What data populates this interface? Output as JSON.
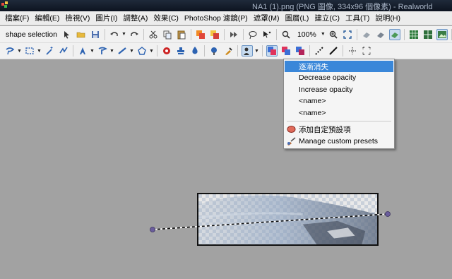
{
  "window": {
    "title": "NA1 (1).png (PNG 圖像, 334x96 個像素) - Realworld"
  },
  "menu": [
    "檔案(F)",
    "編輯(E)",
    "檢視(V)",
    "圖片(I)",
    "調整(A)",
    "效果(C)",
    "PhotoShop 濾鏡(P)",
    "遮罩(M)",
    "圖層(L)",
    "建立(C)",
    "工具(T)",
    "說明(H)"
  ],
  "toolbar1": {
    "tool_name": "shape selection",
    "zoom": "100%"
  },
  "dropdown": {
    "items": [
      {
        "label": "逐漸消失",
        "selected": true
      },
      {
        "label": "Decrease opacity"
      },
      {
        "label": "Increase opacity"
      },
      {
        "label": "<name>"
      },
      {
        "label": "<name>"
      }
    ],
    "presets": [
      {
        "label": "添加自定預設項",
        "icon": "add-preset-icon"
      },
      {
        "label": "Manage custom presets",
        "icon": "manage-presets-icon"
      }
    ]
  },
  "colors": {
    "highlight": "#3a87d9",
    "handle": "#6a5d9c"
  }
}
